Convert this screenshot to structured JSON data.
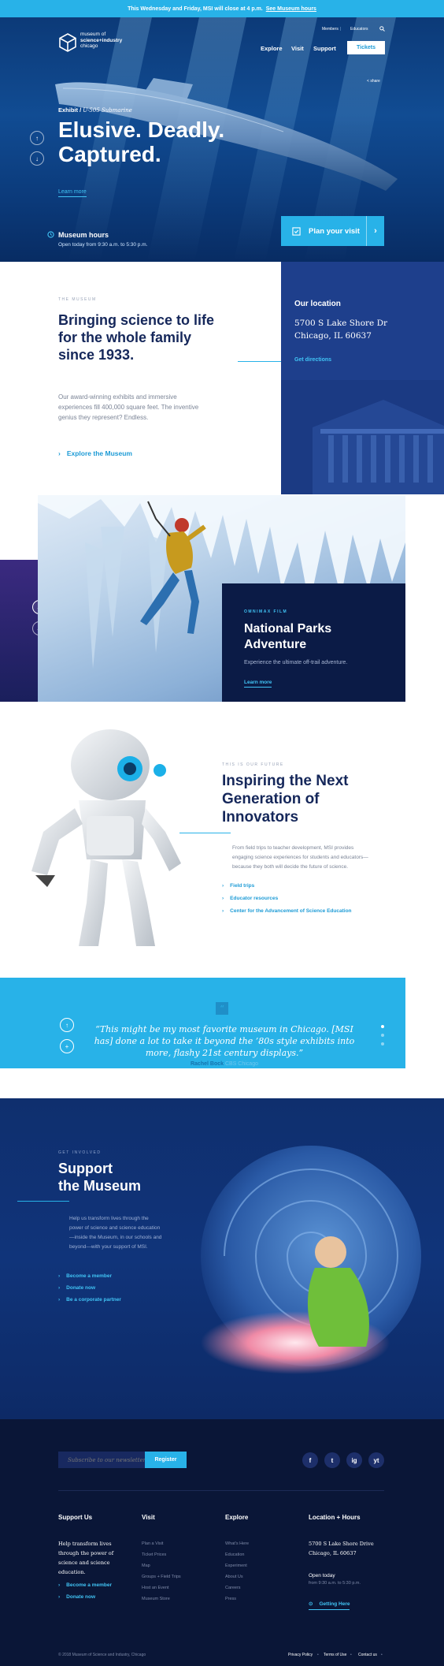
{
  "alert": {
    "message": "This Wednesday and Friday, MSI will close at 4 p.m.",
    "link": "See Museum hours"
  },
  "header": {
    "logo_line1": "museum of",
    "logo_line2": "science+industry",
    "logo_line3": "chicago",
    "util_nav": [
      "Members",
      "Educators"
    ],
    "nav": [
      "Explore",
      "Visit",
      "Support"
    ],
    "tickets": "Tickets"
  },
  "hero": {
    "exhibit_label": "Exhibit /",
    "exhibit_name": "U-505 Submarine",
    "title_line1": "Elusive. Deadly.",
    "title_line2": "Captured.",
    "learn_more": "Learn more",
    "share": "share",
    "hours_title": "Museum hours",
    "hours_sub": "Open today from 9:30 a.m. to 5:30 p.m.",
    "plan_visit": "Plan your visit"
  },
  "intro": {
    "eyebrow": "THE MUSEUM",
    "title": "Bringing science to life for the whole family since 1933.",
    "body": "Our award-winning exhibits and immersive experiences fill 400,000 square feet. The inventive genius they represent? Endless.",
    "link": "Explore the Museum"
  },
  "location": {
    "title": "Our location",
    "address_line1": "5700 S Lake Shore Dr",
    "address_line2": "Chicago, IL 60637",
    "directions": "Get directions"
  },
  "omnimax": {
    "eyebrow": "OMNIMAX FILM",
    "title": "National Parks Adventure",
    "subtitle": "Experience the ultimate off-trail adventure.",
    "link": "Learn more"
  },
  "innovators": {
    "eyebrow": "THIS IS OUR FUTURE",
    "title": "Inspiring the Next Generation of Innovators",
    "body": "From field trips to teacher development, MSI provides engaging science experiences for students and educators—because they both will decide the future of science.",
    "links": [
      "Field trips",
      "Educator resources",
      "Center for the Advancement of Science Education"
    ]
  },
  "quote": {
    "text": "“This might be my most favorite museum in Chicago. [MSI has] done a lot to take it beyond the ’80s style exhibits into more, flashy 21st century displays.”",
    "author": "Rachel Bock",
    "source": "CBS Chicago"
  },
  "support": {
    "eyebrow": "GET INVOLVED",
    "title_line1": "Support",
    "title_line2": "the Museum",
    "body": "Help us transform lives through the power of science and science education—inside the Museum, in our schools and beyond—with your support of MSI.",
    "links": [
      "Become a member",
      "Donate now",
      "Be a corporate partner"
    ]
  },
  "footer": {
    "newsletter_placeholder": "Subscribe to our newsletter",
    "register": "Register",
    "social": [
      "f",
      "t",
      "ig",
      "yt"
    ],
    "col1": {
      "title": "Support Us",
      "text": "Help transform lives through the power of science and science education.",
      "links": [
        "Become a member",
        "Donate now"
      ]
    },
    "col2": {
      "title": "Visit",
      "items": [
        "Plan a Visit",
        "Ticket Prices",
        "Map",
        "Groups + Field Trips",
        "Host an Event",
        "Museum Store"
      ]
    },
    "col3": {
      "title": "Explore",
      "items": [
        "What's Here",
        "Education",
        "Experiment",
        "About Us",
        "Careers",
        "Press"
      ]
    },
    "col4": {
      "title": "Location + Hours",
      "address_line1": "5700 S Lake Shore Drive",
      "address_line2": "Chicago, IL 60637",
      "open_label": "Open today",
      "hours": "from 9:30 a.m. to 5:30 p.m.",
      "directions": "Getting Here"
    },
    "copyright": "© 2018 Museum of Science and Industry, Chicago",
    "legal_links": [
      "Privacy Policy",
      "Terms of Use",
      "Contact us"
    ]
  }
}
